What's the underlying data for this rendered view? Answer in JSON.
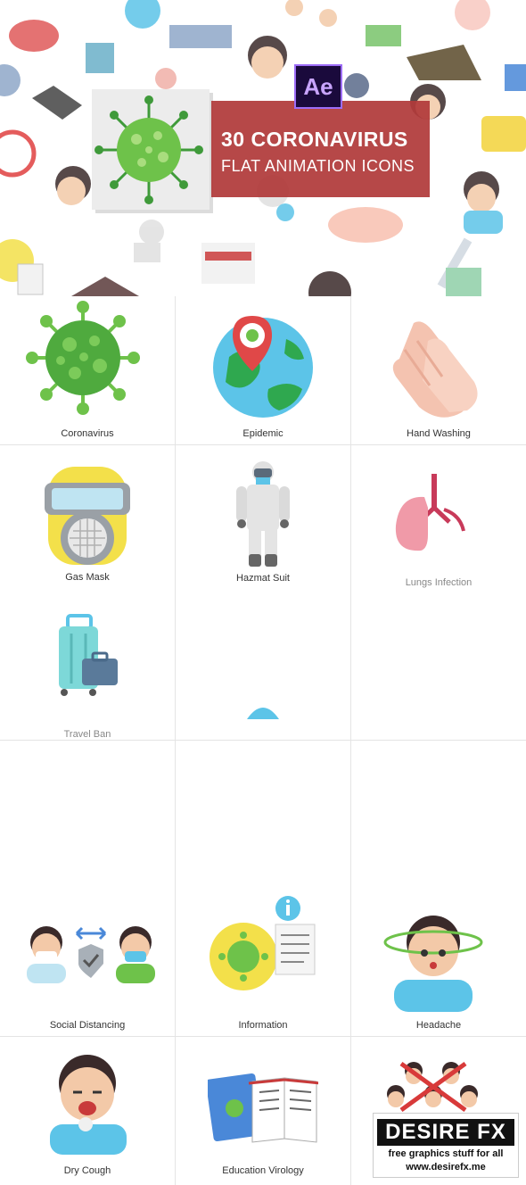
{
  "hero": {
    "title": "30 CORONAVIRUS",
    "subtitle": "FLAT ANIMATION ICONS",
    "badge": "Ae",
    "colors": {
      "banner": "#b03a3a",
      "badge_bg": "#1a0a3c",
      "badge_text": "#c8a4ff"
    }
  },
  "icons": [
    {
      "label": "Coronavirus",
      "icon": "virus-icon"
    },
    {
      "label": "Epidemic",
      "icon": "globe-pin-icon"
    },
    {
      "label": "Hand Washing",
      "icon": "hands-icon"
    },
    {
      "label": "Gas Mask",
      "icon": "gas-mask-icon"
    },
    {
      "label": "Hazmat Suit",
      "icon": "hazmat-suit-icon"
    },
    {
      "label": "Lungs Infection",
      "icon": "lungs-icon"
    },
    {
      "label": "Travel Ban",
      "icon": "luggage-icon"
    },
    {
      "label": "Social Distancing",
      "icon": "social-distancing-icon"
    },
    {
      "label": "Information",
      "icon": "information-icon"
    },
    {
      "label": "Headache",
      "icon": "headache-icon"
    },
    {
      "label": "Dry Cough",
      "icon": "dry-cough-icon"
    },
    {
      "label": "Education Virology",
      "icon": "book-icon"
    }
  ],
  "watermark": {
    "logo": "DESIRE FX",
    "line1": "free graphics stuff for all",
    "line2": "www.desirefx.me"
  }
}
